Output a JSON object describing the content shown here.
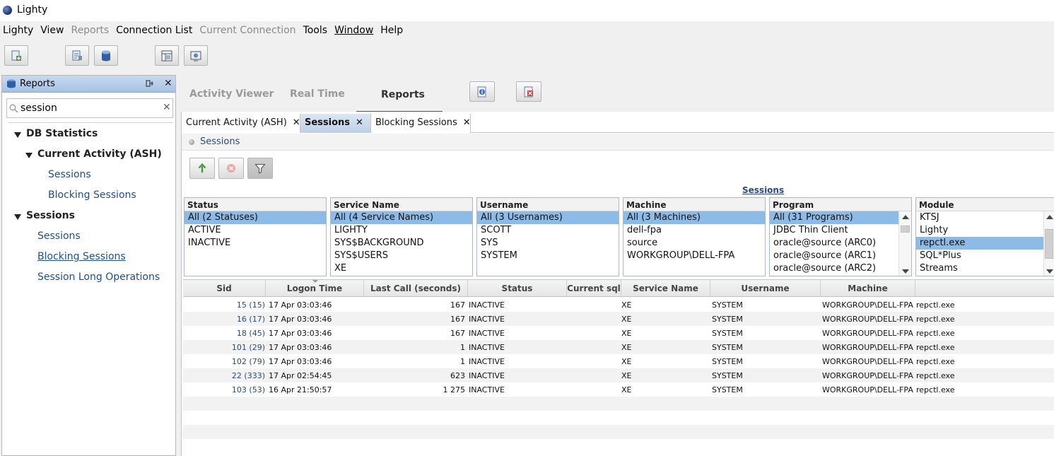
{
  "window": {
    "title": "Lighty"
  },
  "menubar": [
    {
      "label": "Lighty",
      "state": "normal"
    },
    {
      "label": "View",
      "state": "normal"
    },
    {
      "label": "Reports",
      "state": "disabled"
    },
    {
      "label": "Connection List",
      "state": "normal"
    },
    {
      "label": "Current Connection",
      "state": "disabled"
    },
    {
      "label": "Tools",
      "state": "normal"
    },
    {
      "label": "Window",
      "state": "underlined"
    },
    {
      "label": "Help",
      "state": "normal"
    }
  ],
  "toolbar": {
    "icons": [
      "new-connection-icon",
      "connection-properties-icon",
      "database-icon",
      "window-layout-icon",
      "screenshot-icon"
    ]
  },
  "left_panel": {
    "title": "Reports",
    "search_value": "session",
    "tree": [
      {
        "label": "DB Statistics",
        "kind": "group",
        "level": 0
      },
      {
        "label": "Current Activity (ASH)",
        "kind": "group",
        "level": 1
      },
      {
        "label": "Sessions",
        "kind": "leaf",
        "level": 2
      },
      {
        "label": "Blocking Sessions",
        "kind": "leaf",
        "level": 2
      },
      {
        "label": "Sessions",
        "kind": "group",
        "level": 0
      },
      {
        "label": "Sessions",
        "kind": "leaf",
        "level": 1
      },
      {
        "label": "Blocking Sessions",
        "kind": "leaf",
        "level": 1,
        "underlined": true
      },
      {
        "label": "Session Long Operations",
        "kind": "leaf",
        "level": 1
      }
    ]
  },
  "main_tabs": [
    {
      "label": "Activity Viewer",
      "active": false
    },
    {
      "label": "Real Time",
      "active": false
    },
    {
      "label": "Reports",
      "active": true
    }
  ],
  "report_tabs": [
    {
      "label": "Current Activity (ASH)",
      "active": false
    },
    {
      "label": "Sessions",
      "active": true
    },
    {
      "label": "Blocking Sessions",
      "active": false
    }
  ],
  "report": {
    "strip_title": "Sessions",
    "filters_title": "Sessions",
    "filters": [
      {
        "header": "Status",
        "items": [
          "All (2 Statuses)",
          "ACTIVE",
          "INACTIVE"
        ],
        "selected": 0
      },
      {
        "header": "Service Name",
        "items": [
          "All (4 Service Names)",
          "LIGHTY",
          "SYS$BACKGROUND",
          "SYS$USERS",
          "XE"
        ],
        "selected": 0
      },
      {
        "header": "Username",
        "items": [
          "All (3 Usernames)",
          "SCOTT",
          "SYS",
          "SYSTEM"
        ],
        "selected": 0
      },
      {
        "header": "Machine",
        "items": [
          "All (3 Machines)",
          "dell-fpa",
          "source",
          "WORKGROUP\\DELL-FPA"
        ],
        "selected": 0
      },
      {
        "header": "Program",
        "items": [
          "All (31 Programs)",
          "JDBC Thin Client",
          "oracle@source (ARC0)",
          "oracle@source (ARC1)",
          "oracle@source (ARC2)"
        ],
        "selected": 0
      },
      {
        "header": "Module",
        "items": [
          "KTSJ",
          "Lighty",
          "repctl.exe",
          "SQL*Plus",
          "Streams"
        ],
        "selected": 2
      }
    ],
    "columns": [
      "Sid",
      "Logon Time",
      "Last Call (seconds)",
      "Status",
      "Current sql",
      "Service Name",
      "Username",
      "Machine",
      ""
    ],
    "rows": [
      {
        "sid": "15 (15)",
        "logon": "17 Apr  03:03:46",
        "last_call": "167",
        "status": "INACTIVE",
        "sql": "",
        "service": "XE",
        "user": "SYSTEM",
        "machine": "WORKGROUP\\DELL-FPA",
        "module": "repctl.exe"
      },
      {
        "sid": "16 (17)",
        "logon": "17 Apr  03:03:46",
        "last_call": "167",
        "status": "INACTIVE",
        "sql": "",
        "service": "XE",
        "user": "SYSTEM",
        "machine": "WORKGROUP\\DELL-FPA",
        "module": "repctl.exe"
      },
      {
        "sid": "18 (45)",
        "logon": "17 Apr  03:03:46",
        "last_call": "167",
        "status": "INACTIVE",
        "sql": "",
        "service": "XE",
        "user": "SYSTEM",
        "machine": "WORKGROUP\\DELL-FPA",
        "module": "repctl.exe"
      },
      {
        "sid": "101 (29)",
        "logon": "17 Apr  03:03:46",
        "last_call": "1",
        "status": "INACTIVE",
        "sql": "",
        "service": "XE",
        "user": "SYSTEM",
        "machine": "WORKGROUP\\DELL-FPA",
        "module": "repctl.exe"
      },
      {
        "sid": "102 (79)",
        "logon": "17 Apr  03:03:46",
        "last_call": "1",
        "status": "INACTIVE",
        "sql": "",
        "service": "XE",
        "user": "SYSTEM",
        "machine": "WORKGROUP\\DELL-FPA",
        "module": "repctl.exe"
      },
      {
        "sid": "22 (333)",
        "logon": "17 Apr  02:54:45",
        "last_call": "623",
        "status": "INACTIVE",
        "sql": "",
        "service": "XE",
        "user": "SYSTEM",
        "machine": "WORKGROUP\\DELL-FPA",
        "module": "repctl.exe"
      },
      {
        "sid": "103 (53)",
        "logon": "16 Apr  21:50:57",
        "last_call": "1 275",
        "status": "INACTIVE",
        "sql": "",
        "service": "XE",
        "user": "SYSTEM",
        "machine": "WORKGROUP\\DELL-FPA",
        "module": "repctl.exe"
      }
    ]
  },
  "colors": {
    "selection": "#8cbbe8",
    "link": "#1f4f8a",
    "header_blue": "#a7c2e4"
  }
}
